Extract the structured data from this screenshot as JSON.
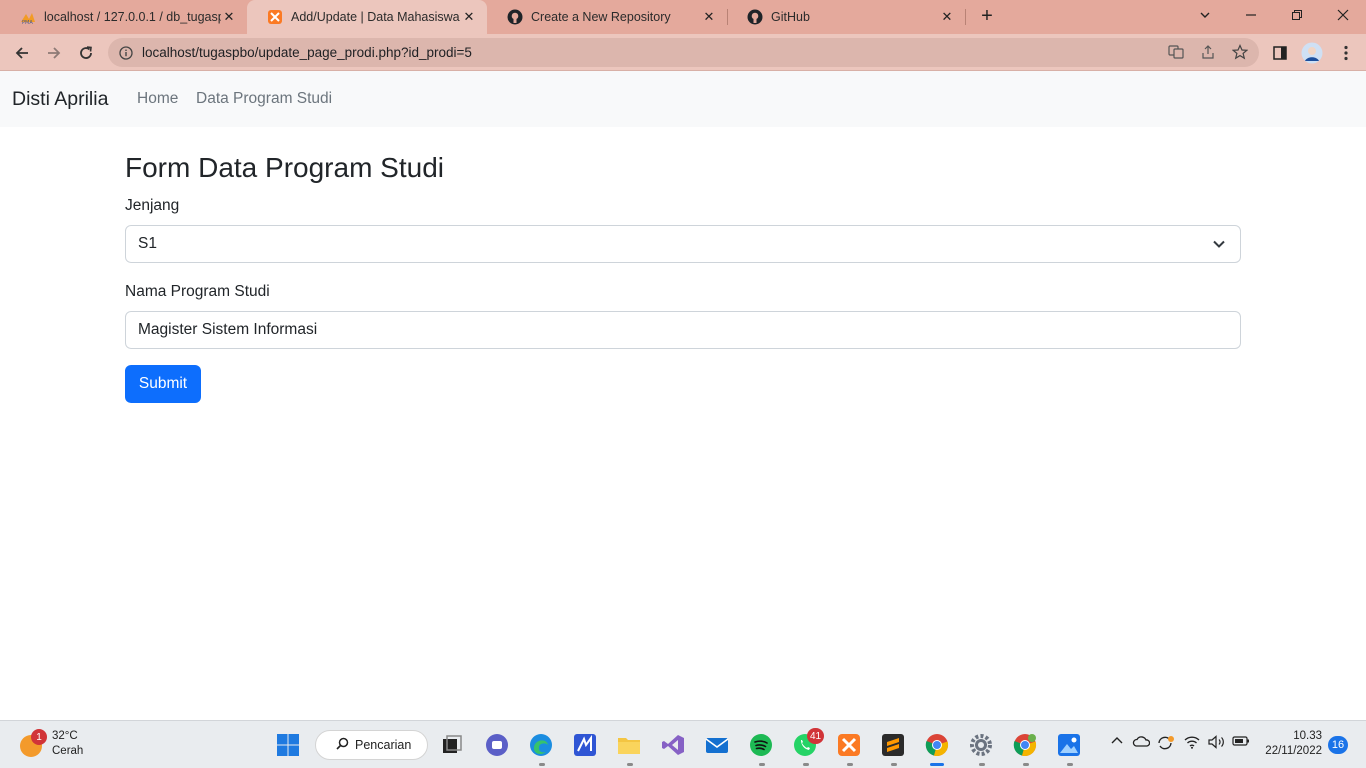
{
  "browser": {
    "tabs": [
      {
        "title": "localhost / 127.0.0.1 / db_tugaspbo",
        "favicon": "phpmyadmin-icon"
      },
      {
        "title": "Add/Update | Data Mahasiswa",
        "favicon": "xampp-icon"
      },
      {
        "title": "Create a New Repository",
        "favicon": "github-icon"
      },
      {
        "title": "GitHub",
        "favicon": "github-icon"
      }
    ],
    "new_tab_label": "+",
    "url": "localhost/tugaspbo/update_page_prodi.php?id_prodi=5"
  },
  "navbar": {
    "brand": "Disti Aprilia",
    "links": [
      "Home",
      "Data Program Studi"
    ]
  },
  "form": {
    "title": "Form Data Program Studi",
    "jenjang_label": "Jenjang",
    "jenjang_value": "S1",
    "nama_label": "Nama Program Studi",
    "nama_value": "Magister Sistem Informasi",
    "submit_label": "Submit"
  },
  "taskbar": {
    "weather_temp": "32°C",
    "weather_desc": "Cerah",
    "weather_badge": "1",
    "search_label": "Pencarian",
    "whatsapp_badge": "41",
    "time": "10.33",
    "date": "22/11/2022",
    "notification_count": "16"
  },
  "colors": {
    "primary": "#0d6efd",
    "tabstrip": "#e4a99c",
    "navbar_bg": "#f8f9fa"
  }
}
